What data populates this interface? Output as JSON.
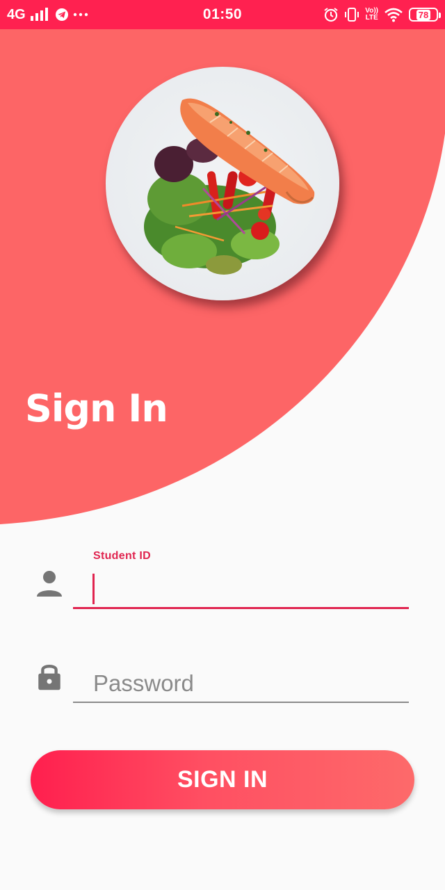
{
  "status_bar": {
    "network": "4G",
    "time": "01:50",
    "volte_top": "Vo))",
    "volte_bottom": "LTE",
    "battery": "78",
    "battery_level": 0.78,
    "background": "#ff2150"
  },
  "header": {
    "title": "Sign In",
    "background": "#fd6566",
    "image": "salmon-salad-plate"
  },
  "form": {
    "student_id": {
      "label": "Student ID",
      "value": "",
      "icon": "person-icon",
      "accent": "#e0244f"
    },
    "password": {
      "placeholder": "Password",
      "value": "",
      "icon": "lock-icon"
    }
  },
  "button": {
    "label": "SIGN IN"
  }
}
